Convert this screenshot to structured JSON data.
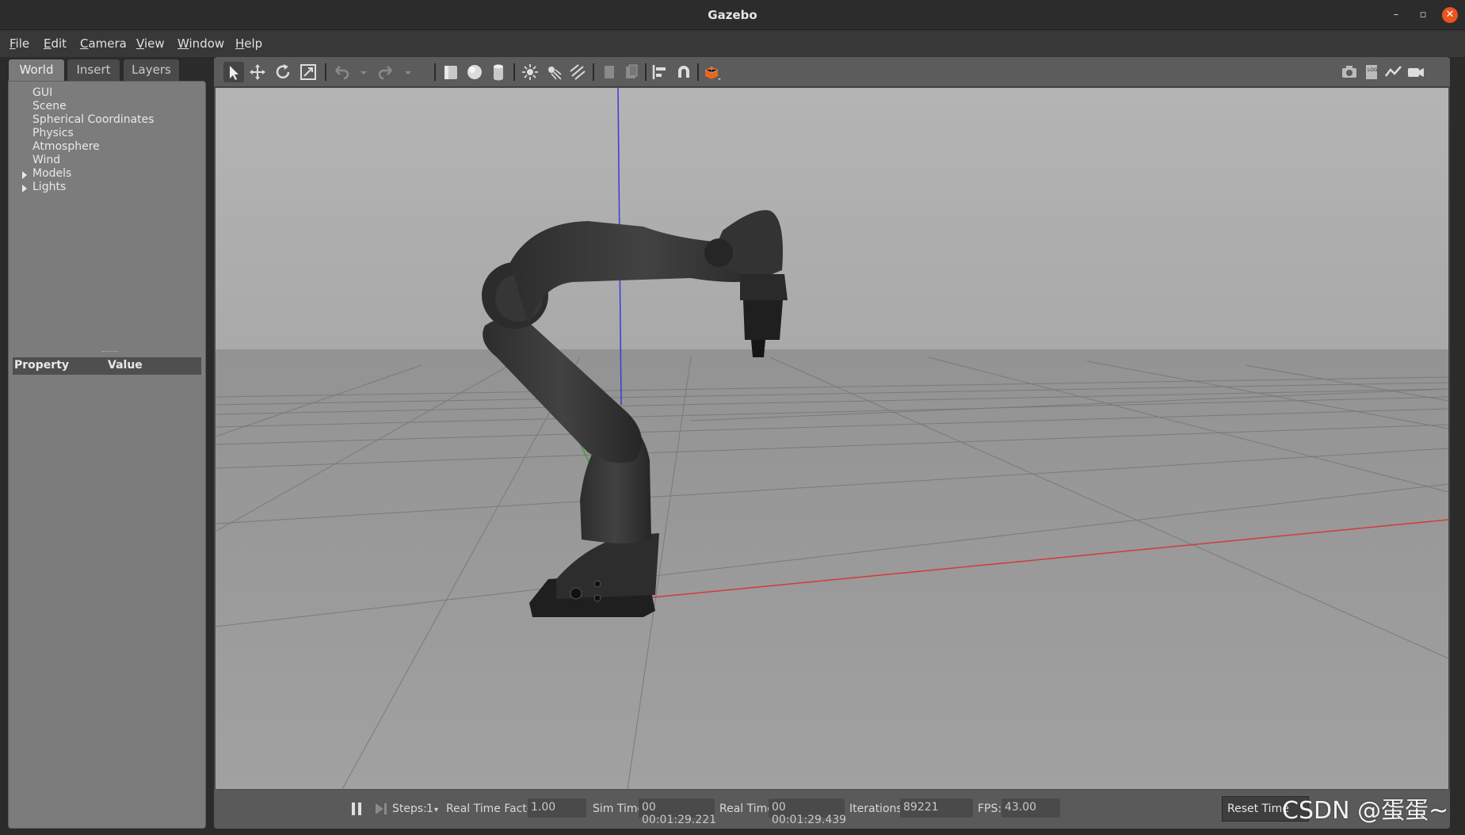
{
  "window": {
    "title": "Gazebo"
  },
  "menu": [
    "File",
    "Edit",
    "Camera",
    "View",
    "Window",
    "Help"
  ],
  "left_panel": {
    "tabs": [
      "World",
      "Insert",
      "Layers"
    ],
    "active_tab": "World",
    "tree": [
      "GUI",
      "Scene",
      "Spherical Coordinates",
      "Physics",
      "Atmosphere",
      "Wind",
      "Models",
      "Lights"
    ],
    "property_header": {
      "property": "Property",
      "value": "Value"
    }
  },
  "toolbar": {
    "tools": [
      "select-arrow-icon",
      "translate-icon",
      "rotate-icon",
      "scale-icon",
      "undo-icon",
      "redo-icon",
      "box-icon",
      "sphere-icon",
      "cylinder-icon",
      "point-light-icon",
      "spot-light-icon",
      "directional-light-icon",
      "copy-icon",
      "paste-icon",
      "align-icon",
      "snap-magnet-icon",
      "view-angle-icon",
      "screenshot-icon",
      "log-icon",
      "plot-icon",
      "video-record-icon"
    ]
  },
  "bottom_bar": {
    "steps_label": "Steps:",
    "steps_value": "1",
    "rtf_label": "Real Time Factor:",
    "rtf_value": "1.00",
    "sim_time_label": "Sim Time:",
    "sim_time_value": "00 00:01:29.221",
    "real_time_label": "Real Time:",
    "real_time_value": "00 00:01:29.439",
    "iterations_label": "Iterations:",
    "iterations_value": "89221",
    "fps_label": "FPS:",
    "fps_value": "43.00",
    "reset_label": "Reset Time"
  },
  "watermark": "CSDN @蛋蛋~"
}
